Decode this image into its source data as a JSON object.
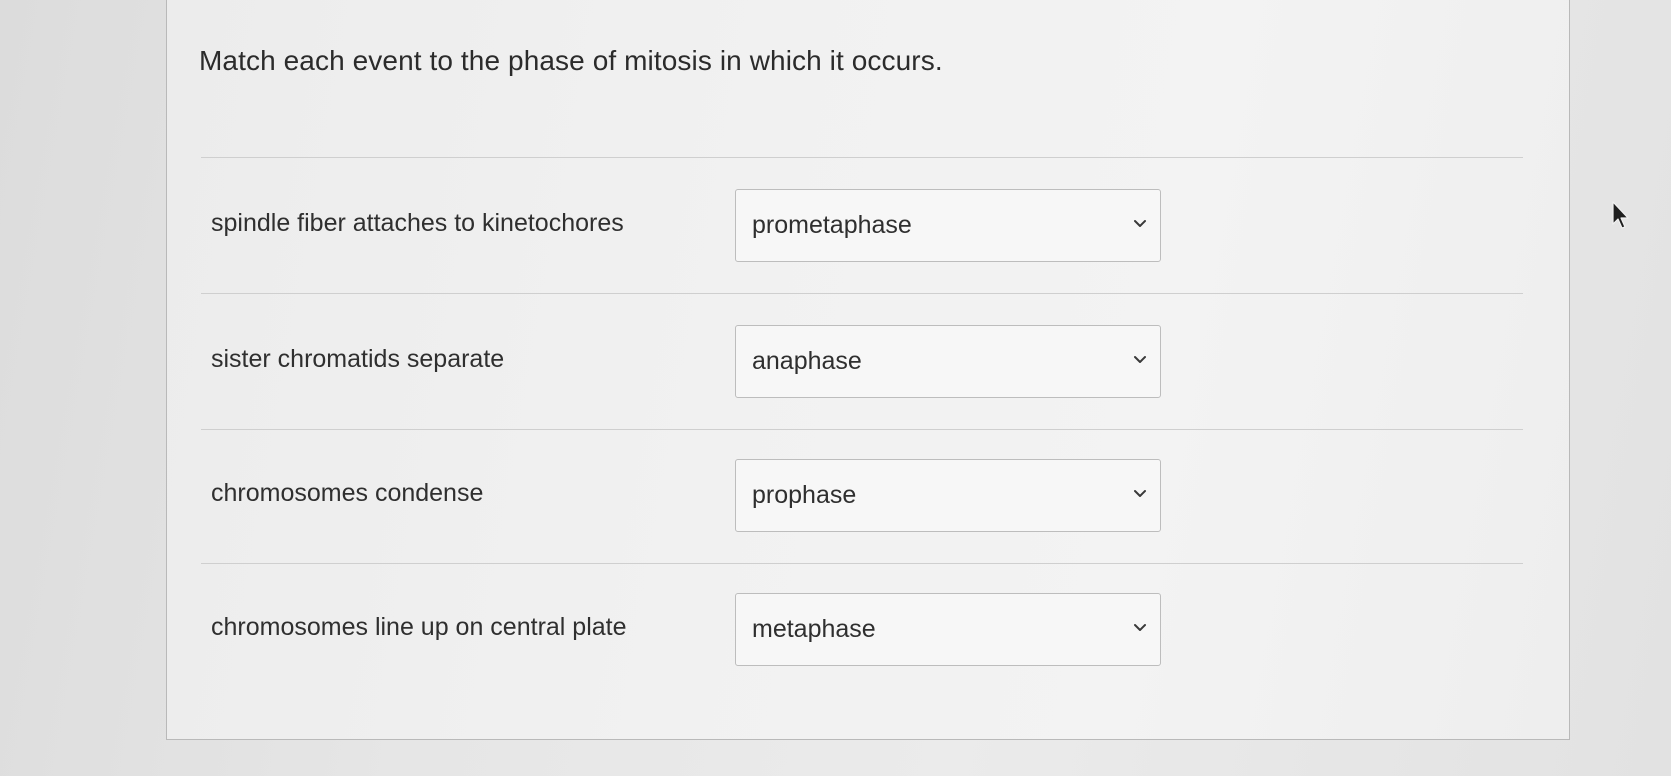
{
  "question": {
    "prompt": "Match each event to the phase of mitosis in which it occurs."
  },
  "matches": [
    {
      "event": "spindle fiber attaches to kinetochores",
      "selected": "prometaphase"
    },
    {
      "event": "sister chromatids separate",
      "selected": "anaphase"
    },
    {
      "event": "chromosomes condense",
      "selected": "prophase"
    },
    {
      "event": "chromosomes line up on central plate",
      "selected": "metaphase"
    }
  ],
  "icons": {
    "dropdown": "chevron-down-icon",
    "pointer": "mouse-cursor-icon"
  },
  "colors": {
    "background": "#e6e6e6",
    "card": "#f1f1f1",
    "border": "#bdbdbd",
    "text": "#2d2d2d"
  }
}
